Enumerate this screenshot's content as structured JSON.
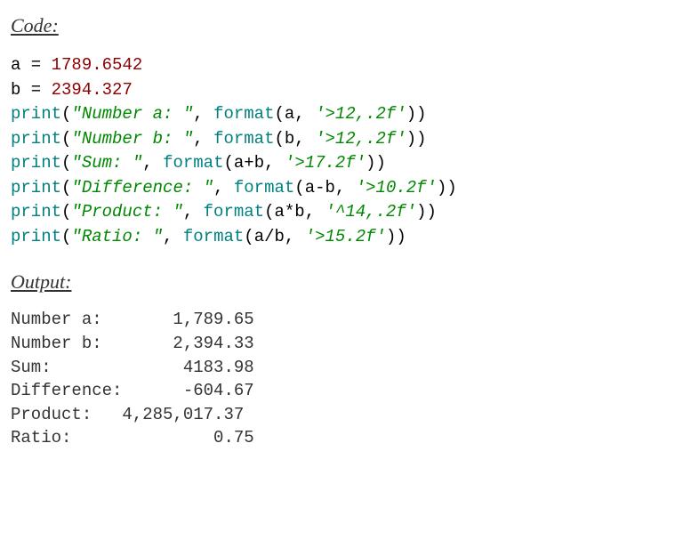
{
  "headings": {
    "code": "Code:",
    "output": "Output:"
  },
  "code": {
    "l1": {
      "a": "a",
      "eq": " = ",
      "v": "1789.6542"
    },
    "l2": {
      "b": "b",
      "eq": " = ",
      "v": "2394.327"
    },
    "l3": {
      "fn": "print",
      "open": "(",
      "s": "\"Number a: \"",
      "c": ", ",
      "fmt": "format",
      "o2": "(",
      "arg": "a",
      "cc": ", ",
      "spec": "'>12,.2f'",
      "close": "))"
    },
    "l4": {
      "fn": "print",
      "open": "(",
      "s": "\"Number b: \"",
      "c": ", ",
      "fmt": "format",
      "o2": "(",
      "arg": "b",
      "cc": ", ",
      "spec": "'>12,.2f'",
      "close": "))"
    },
    "l5": {
      "fn": "print",
      "open": "(",
      "s": "\"Sum: \"",
      "c": ", ",
      "fmt": "format",
      "o2": "(",
      "arg": "a+b",
      "cc": ", ",
      "spec": "'>17.2f'",
      "close": "))"
    },
    "l6": {
      "fn": "print",
      "open": "(",
      "s": "\"Difference: \"",
      "c": ", ",
      "fmt": "format",
      "o2": "(",
      "arg": "a-b",
      "cc": ", ",
      "spec": "'>10.2f'",
      "close": "))"
    },
    "l7": {
      "fn": "print",
      "open": "(",
      "s": "\"Product: \"",
      "c": ", ",
      "fmt": "format",
      "o2": "(",
      "arg": "a*b",
      "cc": ", ",
      "spec": "'^14,.2f'",
      "close": "))"
    },
    "l8": {
      "fn": "print",
      "open": "(",
      "s": "\"Ratio: \"",
      "c": ", ",
      "fmt": "format",
      "o2": "(",
      "arg": "a/b",
      "cc": ", ",
      "spec": "'>15.2f'",
      "close": "))"
    }
  },
  "output": {
    "l1": "Number a:       1,789.65",
    "l2": "Number b:       2,394.33",
    "l3": "Sum:             4183.98",
    "l4": "Difference:      -604.67",
    "l5": "Product:   4,285,017.37 ",
    "l6": "Ratio:              0.75"
  }
}
